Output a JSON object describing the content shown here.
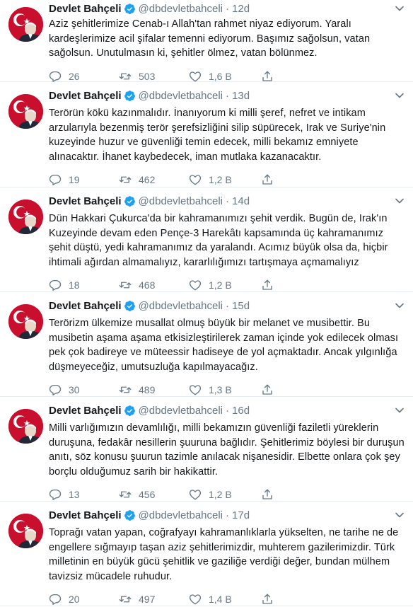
{
  "author": {
    "name": "Devlet Bahçeli",
    "handle": "@dbdevletbahceli"
  },
  "tweets": [
    {
      "time": "12d",
      "text": "Aziz şehitlerimize Cenab-ı Allah'tan rahmet niyaz ediyorum. Yaralı kardeşlerimize acil şifalar temenni ediyorum. Başımız sağolsun, vatan sağolsun. Unutulmasın ki, şehitler ölmez, vatan bölünmez.",
      "replies": "26",
      "retweets": "503",
      "likes": "1,6 B"
    },
    {
      "time": "13d",
      "text": "Terörün kökü kazınmalıdır. İnanıyorum ki milli şeref, nefret ve intikam arzularıyla bezenmiş terör şerefsizliğini silip süpürecek, Irak ve Suriye'nin kuzeyinde huzur ve güvenliği temin edecek, milli bekamız emniyete alınacaktır. İhanet kaybedecek, iman mutlaka kazanacaktır.",
      "replies": "19",
      "retweets": "462",
      "likes": "1,2 B"
    },
    {
      "time": "14d",
      "text": "Dün Hakkari Çukurca'da bir kahramanımızı şehit verdik. Bugün de, Irak'ın Kuzeyinde devam eden Pençe-3 Harekâtı kapsamında üç kahramanımız şehit düştü, yedi kahramanımız da yaralandı. Acımız büyük olsa da, hiçbir ihtimali ağırdan almamalıyız, kararlılığımızı tartışmaya açmamalıyız",
      "replies": "18",
      "retweets": "468",
      "likes": "1,2 B"
    },
    {
      "time": "15d",
      "text": "Terörizm ülkemize musallat olmuş büyük bir melanet ve musibettir. Bu musibetin aşama aşama etkisizleştirilerek zaman içinde yok edilecek olması pek çok badireye ve müteessir hadiseye de yol açmaktadır. Ancak yılgınlığa düşmeyeceğiz, umutsuzluğa kapılmayacağız.",
      "replies": "30",
      "retweets": "489",
      "likes": "1,3 B"
    },
    {
      "time": "16d",
      "text": "Milli varlığımızın devamlılığı, milli bekamızın güvenliği faziletli yüreklerin duruşuna, fedakâr nesillerin şuuruna bağlıdır. Şehitlerimiz böylesi bir duruşun anıtı, söz konusu şuurun tazimle anılacak nişanesidir. Elbette onlara çok şey borçlu olduğumuz sarih bir hakikattir.",
      "replies": "13",
      "retweets": "456",
      "likes": "1,2 B"
    },
    {
      "time": "17d",
      "text": "Toprağı vatan yapan, coğrafyayı kahramanlıklarla yükselten, ne tarihe ne de engellere sığmayıp taşan aziz şehitlerimizdir, muhterem gazilerimizdir. Türk milletinin en büyük gücü şehitlik ve gaziliğe verdiği değer, bundan mülhem tavizsiz mücadele ruhudur.",
      "replies": "20",
      "retweets": "497",
      "likes": "1,4 B"
    }
  ],
  "colors": {
    "text": "#14171a",
    "muted": "#657786",
    "verified": "#1da1f2",
    "divider": "#e6ecf0",
    "flag_red": "#c8102e"
  }
}
